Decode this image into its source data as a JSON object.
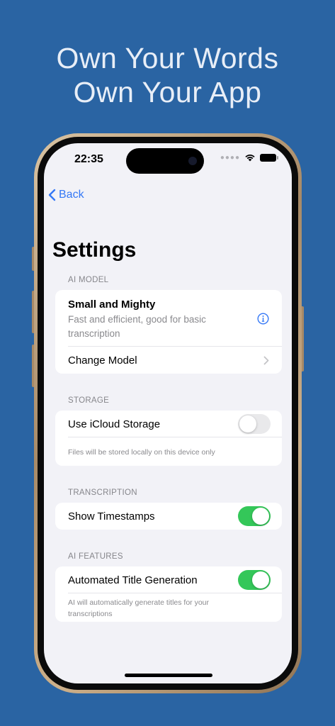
{
  "headline": {
    "line1": "Own Your Words",
    "line2": "Own Your App"
  },
  "status_bar": {
    "time": "22:35",
    "icons": [
      "cellular-dots-icon",
      "wifi-icon",
      "battery-icon"
    ]
  },
  "nav": {
    "back_label": "Back"
  },
  "page": {
    "title": "Settings"
  },
  "sections": {
    "ai_model": {
      "header": "AI MODEL",
      "model_name": "Small and Mighty",
      "model_description": "Fast and efficient, good for basic transcription",
      "change_model_label": "Change Model"
    },
    "storage": {
      "header": "STORAGE",
      "icloud_label": "Use iCloud Storage",
      "icloud_enabled": false,
      "footnote": "Files will be stored locally on this device only"
    },
    "transcription": {
      "header": "TRANSCRIPTION",
      "timestamps_label": "Show Timestamps",
      "timestamps_enabled": true
    },
    "ai_features": {
      "header": "AI FEATURES",
      "title_gen_label": "Automated Title Generation",
      "title_gen_enabled": true,
      "footnote": "AI will automatically generate titles for your transcriptions"
    }
  },
  "colors": {
    "background": "#2a64a3",
    "accent": "#3478f6",
    "toggle_on": "#34c759",
    "toggle_off": "#e9e9eb"
  }
}
